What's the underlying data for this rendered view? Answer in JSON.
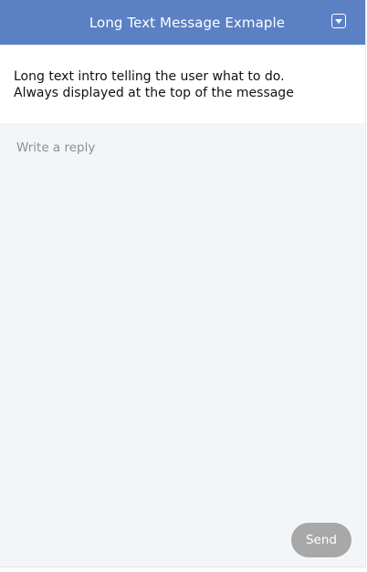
{
  "header": {
    "title": "Long Text Message Exmaple",
    "toggle_icon": "caret-down-icon",
    "background_color": "#5b80c4"
  },
  "intro": {
    "lines": [
      "Long text intro telling the user what to do.",
      "Always displayed at the top of the message"
    ]
  },
  "reply": {
    "placeholder": "Write a reply",
    "value": ""
  },
  "send": {
    "label": "Send",
    "color": "#a8a8a8"
  }
}
